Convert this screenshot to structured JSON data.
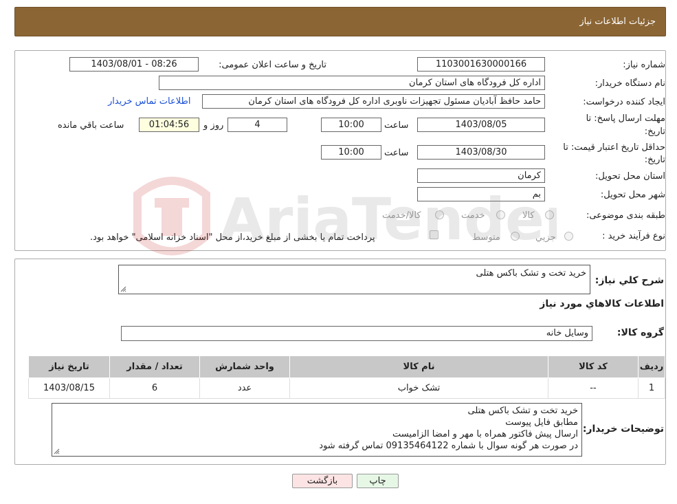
{
  "header": {
    "title": "جزئیات اطلاعات نیاز"
  },
  "form": {
    "need_number_label": "شماره نیاز:",
    "need_number": "1103001630000166",
    "announce_label": "تاریخ و ساعت اعلان عمومی:",
    "announce_value": "1403/08/01 - 08:26",
    "buyer_org_label": "نام دستگاه خریدار:",
    "buyer_org": "اداره کل فرودگاه های استان کرمان",
    "creator_label": "ایجاد کننده درخواست:",
    "creator": "حامد حافظ آبادیان مسئول تجهیزات ناوبری اداره کل فرودگاه های استان کرمان",
    "contact_link": "اطلاعات تماس خریدار",
    "deadline_label_1": "مهلت ارسال پاسخ: تا",
    "deadline_label_2": "تاریخ:",
    "deadline_date": "1403/08/05",
    "time_word": "ساعت",
    "deadline_time": "10:00",
    "days_value": "4",
    "days_word": "روز و",
    "remaining_time": "01:04:56",
    "remaining_word": "ساعت باقي مانده",
    "validity_label_1": "حداقل تاریخ اعتبار قیمت: تا",
    "validity_label_2": "تاریخ:",
    "validity_date": "1403/08/30",
    "validity_time": "10:00",
    "province_label": "استان محل تحویل:",
    "province": "کرمان",
    "city_label": "شهر محل تحویل:",
    "city": "بم",
    "category_label": "طبقه بندی موضوعی:",
    "category_options": [
      "کالا",
      "خدمت",
      "کالا/خدمت"
    ],
    "process_label": "نوع فرآیند خرید :",
    "process_options": [
      "جزيي",
      "متوسط"
    ],
    "payment_note": "پرداخت تمام یا بخشی از مبلغ خرید،از محل \"اسناد خزانه اسلامی\" خواهد بود."
  },
  "details": {
    "summary_label": "شرح کلي نياز:",
    "summary": "خرید تخت و تشک باکس هتلی",
    "goods_title": "اطلاعات کالاهاي مورد نياز",
    "group_label": "گروه کالا:",
    "group": "وسایل خانه",
    "table": {
      "headers": [
        "رديف",
        "کد کالا",
        "نام کالا",
        "واحد شمارش",
        "تعداد / مقدار",
        "تاريخ نياز"
      ],
      "rows": [
        [
          "1",
          "--",
          "تشک خواب",
          "عدد",
          "6",
          "1403/08/15"
        ]
      ]
    },
    "buyer_notes_label": "توضیحات خریدار:",
    "buyer_notes": [
      "خرید تخت و تشک باکس هتلی",
      "مطابق فایل پیوست",
      "ارسال پیش فاکتور همراه با مهر و امضا الزامیست",
      "در صورت هر گونه سوال با شماره 09135464122 تماس گرفته شود"
    ]
  },
  "buttons": {
    "print": "چاپ",
    "back": "بازگشت"
  },
  "watermark": {
    "text": "AriaTender.neT"
  },
  "colors": {
    "header": "#8b6534",
    "link": "#1a4fd6",
    "back_button": "#fde4e4",
    "print_button": "#e6f7e6",
    "yellow_box": "#ffffe0"
  }
}
